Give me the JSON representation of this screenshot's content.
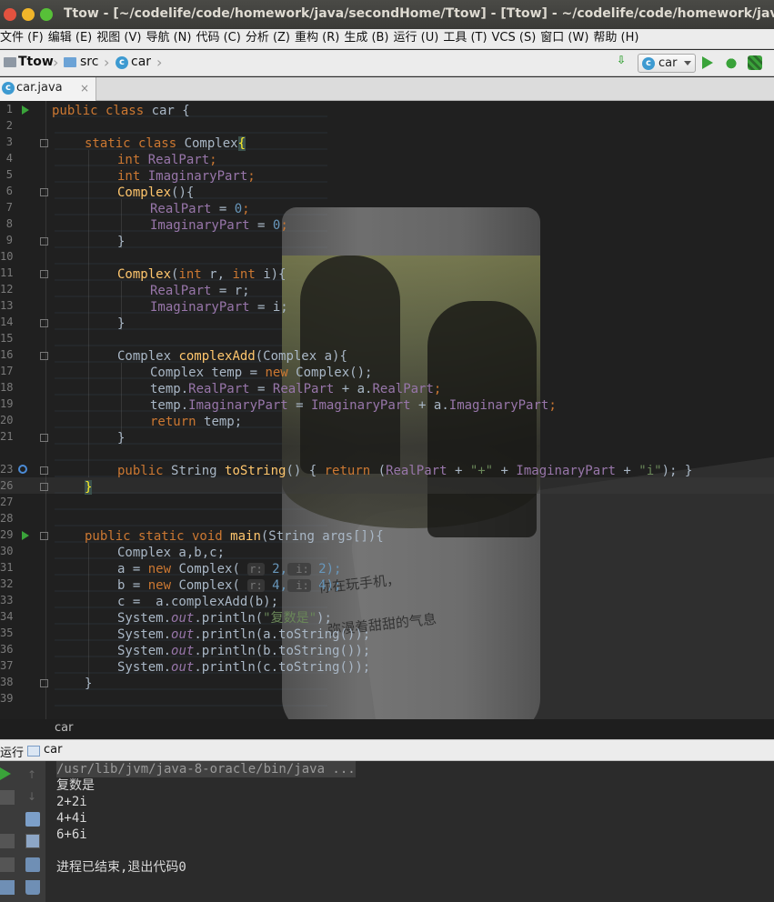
{
  "window": {
    "title": "Ttow - [~/codelife/code/homework/java/secondHome/Ttow] - [Ttow] - ~/codelife/code/homework/java/secondHome/Ttow/src/car.java"
  },
  "menu": [
    "文件 (F)",
    "编辑 (E)",
    "视图 (V)",
    "导航 (N)",
    "代码 (C)",
    "分析 (Z)",
    "重构 (R)",
    "生成 (B)",
    "运行 (U)",
    "工具 (T)",
    "VCS (S)",
    "窗口 (W)",
    "帮助 (H)"
  ],
  "breadcrumb": {
    "project": "Ttow",
    "src": "src",
    "file": "car"
  },
  "run_config": {
    "selected": "car"
  },
  "tab": {
    "label": "car.java",
    "close": "×"
  },
  "colors": {
    "keyword": "#cc7832",
    "field": "#9876aa",
    "number": "#6897bb",
    "string": "#6a8759",
    "function": "#ffc66d",
    "text": "#a9b7c6"
  },
  "gutter": {
    "line_numbers": [
      "1",
      "2",
      "3",
      "4",
      "5",
      "6",
      "7",
      "8",
      "9",
      "10",
      "11",
      "12",
      "13",
      "14",
      "15",
      "16",
      "17",
      "18",
      "19",
      "20",
      "21",
      "23",
      "26",
      "27",
      "28",
      "29",
      "30",
      "31",
      "32",
      "33",
      "34",
      "35",
      "36",
      "37",
      "38",
      "39"
    ]
  },
  "code": {
    "l1": [
      "public class ",
      "car {"
    ],
    "l3": [
      "static class ",
      "Complex",
      "{"
    ],
    "l4": [
      "int ",
      "RealPart",
      ";"
    ],
    "l5": [
      "int ",
      "ImaginaryPart",
      ";"
    ],
    "l6": [
      "Complex",
      "(){"
    ],
    "l7": [
      "RealPart",
      " = ",
      "0",
      ";"
    ],
    "l8": [
      "ImaginaryPart",
      " = ",
      "0",
      ";"
    ],
    "l9": "}",
    "l11": [
      "Complex",
      "(",
      "int ",
      "r, ",
      "int ",
      "i){"
    ],
    "l12": [
      "RealPart",
      " = r;"
    ],
    "l13": [
      "ImaginaryPart",
      " = i;"
    ],
    "l14": "}",
    "l16": [
      "Complex ",
      "complexAdd",
      "(Complex a){"
    ],
    "l17": [
      "Complex temp = ",
      "new ",
      "Complex();"
    ],
    "l18": [
      "temp.",
      "RealPart",
      " = ",
      "RealPart",
      " + a.",
      "RealPart",
      ";"
    ],
    "l19": [
      "temp.",
      "ImaginaryPart",
      " = ",
      "ImaginaryPart",
      " + a.",
      "ImaginaryPart",
      ";"
    ],
    "l20": [
      "return ",
      "temp;"
    ],
    "l21": "}",
    "l23": [
      "public ",
      "String ",
      "toString",
      "() { ",
      "return ",
      "(",
      "RealPart",
      " + ",
      "\"+\"",
      " + ",
      "ImaginaryPart",
      " + ",
      "\"i\"",
      "); }"
    ],
    "l26": "}",
    "l29": [
      "public static void ",
      "main",
      "(String args[]){"
    ],
    "l30": [
      "Complex a,b,c;"
    ],
    "l31": [
      "a = ",
      "new ",
      "Complex( ",
      "r:",
      " 2,",
      " i:",
      " 2);"
    ],
    "l32": [
      "b = ",
      "new ",
      "Complex( ",
      "r:",
      " 4,",
      " i:",
      " 4);"
    ],
    "l33": [
      "c =  a.complexAdd(b);"
    ],
    "l34": [
      "System.",
      "out",
      ".println(",
      "\"复数是\"",
      ");"
    ],
    "l35": [
      "System.",
      "out",
      ".println(a.toString());"
    ],
    "l36": [
      "System.",
      "out",
      ".println(b.toString());"
    ],
    "l37": [
      "System.",
      "out",
      ".println(c.toString());"
    ],
    "l38": "}"
  },
  "wallpaper_text": {
    "line1": "你在玩手机，",
    "line2": "弥漫着甜甜的气息"
  },
  "editor_crumb": "car",
  "run_panel": {
    "label": "运行",
    "tab": "car",
    "output": [
      "/usr/lib/jvm/java-8-oracle/bin/java ...",
      "复数是",
      "2+2i",
      "4+4i",
      "6+6i",
      "",
      "进程已结束,退出代码0"
    ]
  }
}
